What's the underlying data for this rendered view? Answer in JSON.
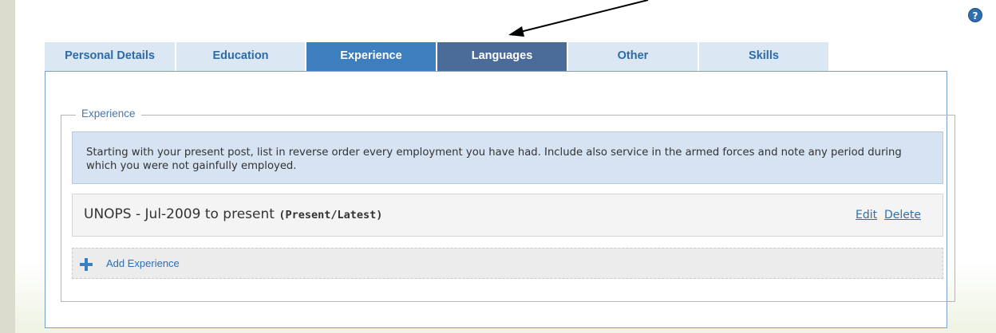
{
  "tabs": [
    {
      "label": "Personal Details"
    },
    {
      "label": "Education"
    },
    {
      "label": "Experience",
      "state": "selected"
    },
    {
      "label": "Languages",
      "state": "hover"
    },
    {
      "label": "Other"
    },
    {
      "label": "Skills"
    }
  ],
  "help": {
    "icon": "help-icon",
    "glyph": "?"
  },
  "section": {
    "legend": "Experience",
    "instructions": "Starting with your present post, list in reverse order every employment you have had. Include also service in the armed forces and note any period during which you were not gainfully employed."
  },
  "entries": [
    {
      "title": "UNOPS - Jul-2009 to present",
      "tag": "(Present/Latest)",
      "edit_label": "Edit",
      "delete_label": "Delete"
    }
  ],
  "add_button": {
    "label": "Add Experience",
    "icon": "plus-icon"
  },
  "colors": {
    "tab_default": "#dce7f4",
    "tab_selected": "#3d7fbe",
    "tab_hover": "#4b6b99",
    "link": "#2f6fb0",
    "info_bg": "#d6e3f2"
  }
}
